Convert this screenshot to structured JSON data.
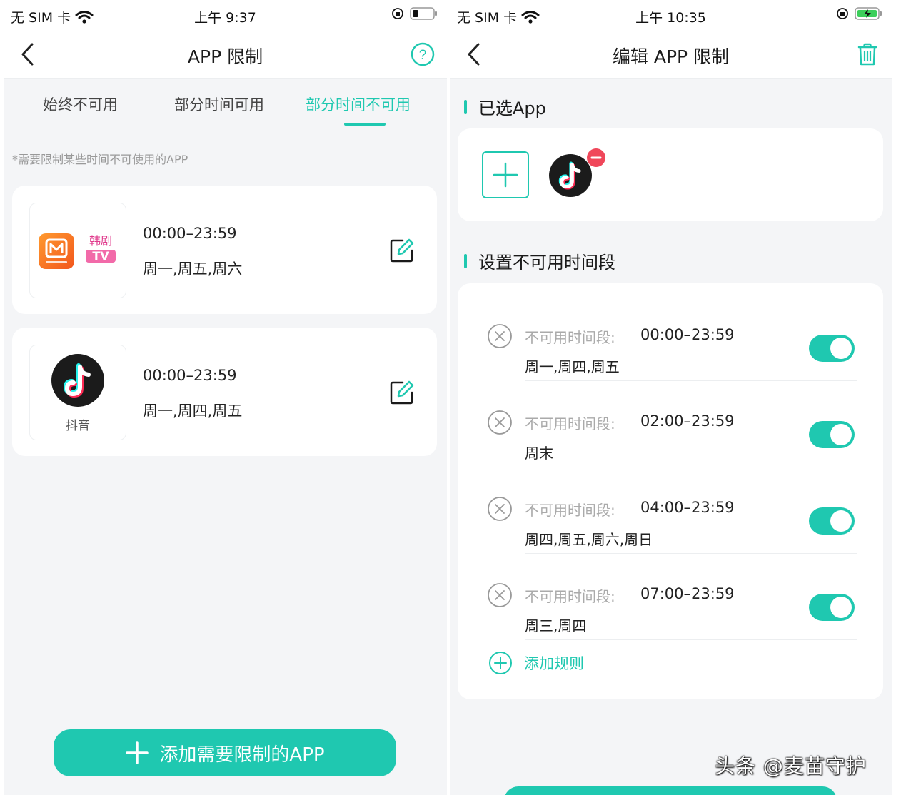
{
  "left_screen": {
    "status": {
      "carrier": "无 SIM 卡",
      "time": "上午 9:37"
    },
    "nav": {
      "title": "APP 限制"
    },
    "tabs": [
      {
        "label": "始终不可用"
      },
      {
        "label": "部分时间可用"
      },
      {
        "label": "部分时间不可用"
      }
    ],
    "active_tab": "部分时间不可用",
    "hint": "*需要限制某些时间不可使用的APP",
    "rules": [
      {
        "apps": [
          "芒果TV",
          "韩剧TV"
        ],
        "time": "00:00–23:59",
        "days": "周一,周五,周六"
      },
      {
        "apps": [
          "抖音"
        ],
        "app_name": "抖音",
        "time": "00:00–23:59",
        "days": "周一,周四,周五"
      }
    ],
    "add_button": "添加需要限制的APP",
    "app_badges": {
      "hanju_line1": "韩剧",
      "hanju_line2": "TV"
    }
  },
  "right_screen": {
    "status": {
      "carrier": "无 SIM 卡",
      "time": "上午 10:35"
    },
    "nav": {
      "title": "编辑 APP 限制"
    },
    "selected_section_title": "已选App",
    "periods_section_title": "设置不可用时间段",
    "periods": [
      {
        "label": "不可用时间段:",
        "time": "00:00–23:59",
        "days": "周一,周四,周五",
        "enabled": true
      },
      {
        "label": "不可用时间段:",
        "time": "02:00–23:59",
        "days": "周末",
        "enabled": true
      },
      {
        "label": "不可用时间段:",
        "time": "04:00–23:59",
        "days": "周四,周五,周六,周日",
        "enabled": true
      },
      {
        "label": "不可用时间段:",
        "time": "07:00–23:59",
        "days": "周三,周四",
        "enabled": true
      }
    ],
    "add_rule": "添加规则"
  },
  "watermark": "头条 @麦苗守护",
  "colors": {
    "accent": "#1fc8b0",
    "remove_badge": "#f0475a",
    "background": "#f4f5f7"
  }
}
